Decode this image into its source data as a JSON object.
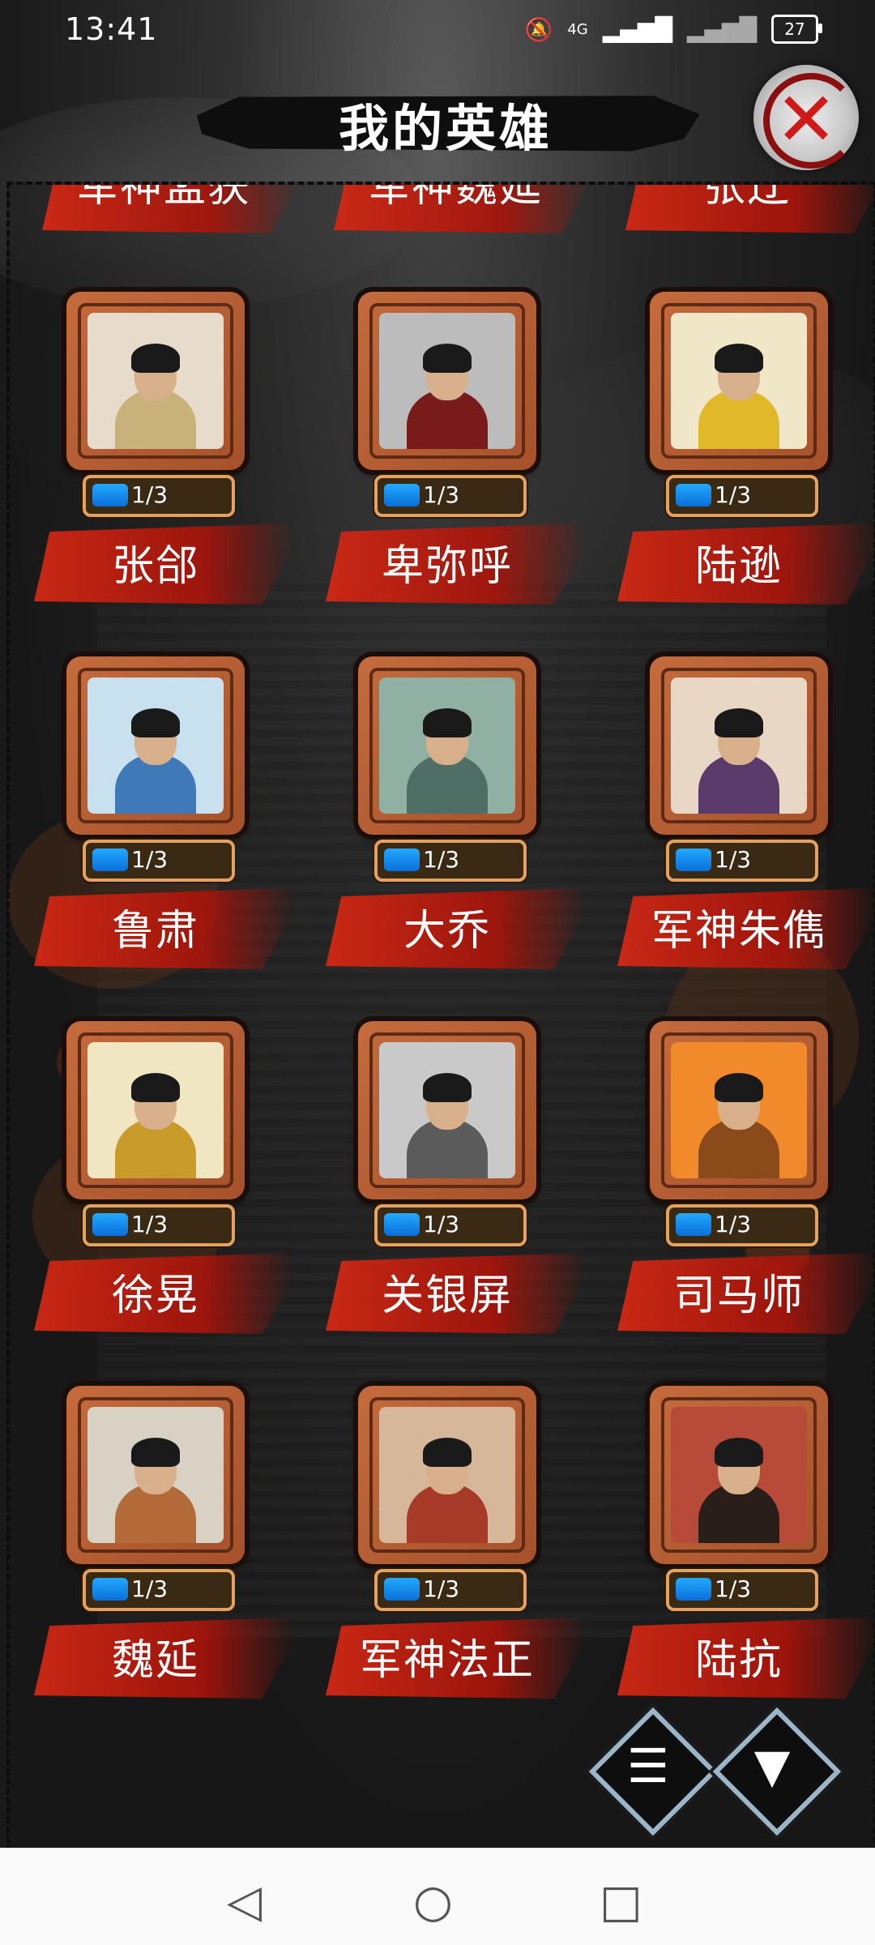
{
  "status_bar": {
    "time": "13:41",
    "network": "4G",
    "battery": "27"
  },
  "title": "我的英雄",
  "partial_row": [
    "军神孟获",
    "军神魏延",
    "张辽"
  ],
  "heroes": [
    {
      "name": "张郃",
      "progress": "1/3",
      "fill": 0.333,
      "palette": {
        "bg": "#e7dccb",
        "robe": "#c9b27a"
      }
    },
    {
      "name": "卑弥呼",
      "progress": "1/3",
      "fill": 0.333,
      "palette": {
        "bg": "#bcbcbc",
        "robe": "#7a1b1b"
      }
    },
    {
      "name": "陆逊",
      "progress": "1/3",
      "fill": 0.333,
      "palette": {
        "bg": "#f0e7c9",
        "robe": "#e0b82a"
      }
    },
    {
      "name": "鲁肃",
      "progress": "1/3",
      "fill": 0.333,
      "palette": {
        "bg": "#c9e0ef",
        "robe": "#3f79b8"
      }
    },
    {
      "name": "大乔",
      "progress": "1/3",
      "fill": 0.333,
      "palette": {
        "bg": "#8fb0a3",
        "robe": "#4e6e66"
      }
    },
    {
      "name": "军神朱儁",
      "progress": "1/3",
      "fill": 0.333,
      "palette": {
        "bg": "#e8d7c4",
        "robe": "#5a3b6b"
      }
    },
    {
      "name": "徐晃",
      "progress": "1/3",
      "fill": 0.333,
      "palette": {
        "bg": "#f1e6c2",
        "robe": "#c99b2a"
      }
    },
    {
      "name": "关银屏",
      "progress": "1/3",
      "fill": 0.333,
      "palette": {
        "bg": "#c9c9c9",
        "robe": "#5b5b5b"
      }
    },
    {
      "name": "司马师",
      "progress": "1/3",
      "fill": 0.333,
      "palette": {
        "bg": "#f08a2a",
        "robe": "#8a4a1a"
      }
    },
    {
      "name": "魏延",
      "progress": "1/3",
      "fill": 0.333,
      "palette": {
        "bg": "#d8d2c4",
        "robe": "#b36b3a"
      }
    },
    {
      "name": "军神法正",
      "progress": "1/3",
      "fill": 0.333,
      "palette": {
        "bg": "#d7b79a",
        "robe": "#a83a2a"
      }
    },
    {
      "name": "陆抗",
      "progress": "1/3",
      "fill": 0.333,
      "palette": {
        "bg": "#b84a3a",
        "robe": "#2a1e1a"
      }
    }
  ],
  "actions": {
    "list_icon": "list-icon",
    "filter_icon": "filter-icon"
  },
  "nav": {
    "back": "◁",
    "home": "○",
    "recents": "□"
  }
}
